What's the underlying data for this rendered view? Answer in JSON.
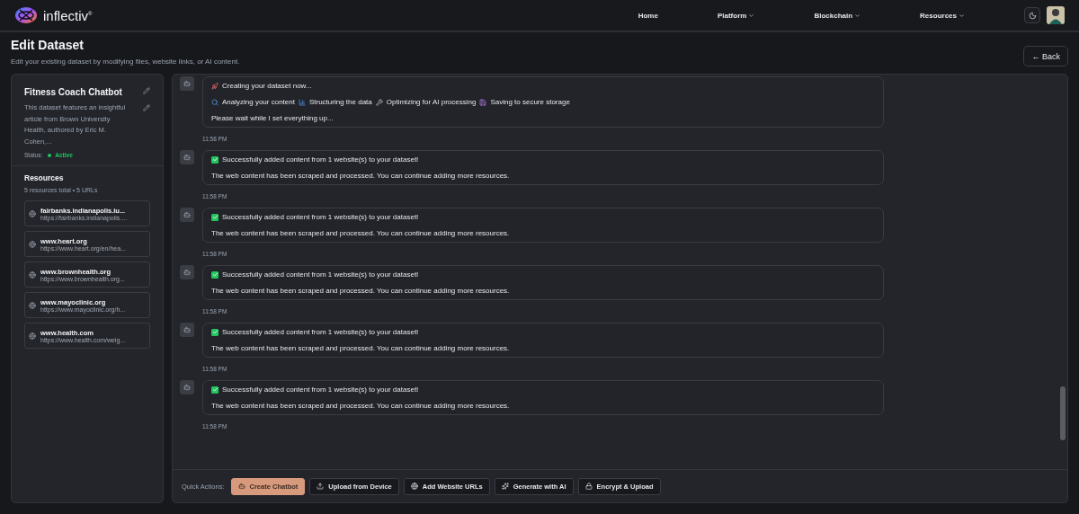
{
  "header": {
    "brand": "inflectiv$^{®}$",
    "nav": [
      {
        "label": "Home",
        "dropdown": false
      },
      {
        "label": "Platform",
        "dropdown": true
      },
      {
        "label": "Blockchain",
        "dropdown": true
      },
      {
        "label": "Resources",
        "dropdown": true
      }
    ]
  },
  "page": {
    "title": "Edit Dataset",
    "subtitle": "Edit your existing dataset by modifying files, website links, or AI content.",
    "back": "← Back"
  },
  "dataset": {
    "name": "Fitness Coach Chatbot",
    "description": "This dataset features an insightful article from Brown University Health, authored by Eric M. Cohen,...",
    "status_label": "Status:",
    "status": "Active"
  },
  "resources": {
    "title": "Resources",
    "summary": "5 resources total • 5 URLs",
    "items": [
      {
        "domain": "fairbanks.indianapolis.iu...",
        "url": "https://fairbanks.indianapolis...."
      },
      {
        "domain": "www.heart.org",
        "url": "https://www.heart.org/en/hea..."
      },
      {
        "domain": "www.brownhealth.org",
        "url": "https://www.brownhealth.org..."
      },
      {
        "domain": "www.mayoclinic.org",
        "url": "https://www.mayoclinic.org/h..."
      },
      {
        "domain": "www.health.com",
        "url": "https://www.health.com/weig..."
      }
    ]
  },
  "messages": [
    {
      "lines": [
        [
          "Creating your dataset now..."
        ],
        [
          "Analyzing your content",
          "Structuring the data",
          "Optimizing for AI processing",
          "Saving to secure storage"
        ],
        [
          "Please wait while I set everything up..."
        ]
      ],
      "time": "11:58 PM"
    },
    {
      "lines": [
        [
          "Successfully added content from 1 website(s) to your dataset!"
        ],
        [
          "The web content has been scraped and processed. You can continue adding more resources."
        ]
      ],
      "time": "11:58 PM"
    },
    {
      "lines": [
        [
          "Successfully added content from 1 website(s) to your dataset!"
        ],
        [
          "The web content has been scraped and processed. You can continue adding more resources."
        ]
      ],
      "time": "11:58 PM"
    },
    {
      "lines": [
        [
          "Successfully added content from 1 website(s) to your dataset!"
        ],
        [
          "The web content has been scraped and processed. You can continue adding more resources."
        ]
      ],
      "time": "11:58 PM"
    },
    {
      "lines": [
        [
          "Successfully added content from 1 website(s) to your dataset!"
        ],
        [
          "The web content has been scraped and processed. You can continue adding more resources."
        ]
      ],
      "time": "11:58 PM"
    },
    {
      "lines": [
        [
          "Successfully added content from 1 website(s) to your dataset!"
        ],
        [
          "The web content has been scraped and processed. You can continue adding more resources."
        ]
      ],
      "time": "11:58 PM"
    }
  ],
  "quick_actions": {
    "label": "Quick Actions:",
    "buttons": [
      {
        "label": "Create Chatbot",
        "primary": true
      },
      {
        "label": "Upload from Device",
        "primary": false
      },
      {
        "label": "Add Website URLs",
        "primary": false
      },
      {
        "label": "Generate with AI",
        "primary": false
      },
      {
        "label": "Encrypt & Upload",
        "primary": false
      }
    ]
  }
}
